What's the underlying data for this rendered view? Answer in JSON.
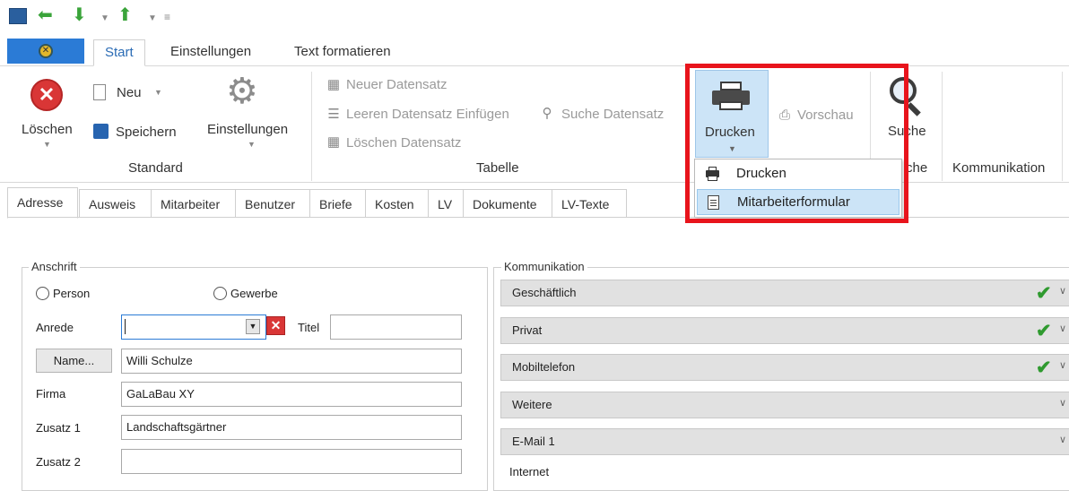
{
  "quick_access": {
    "icons": [
      "app-icon",
      "arrow-left-icon",
      "arrow-down-icon",
      "chevron-down-icon",
      "arrow-up-icon",
      "chevron-down-icon",
      "customize-icon"
    ]
  },
  "tabs": [
    {
      "label": "Start",
      "active": true
    },
    {
      "label": "Einstellungen",
      "active": false
    },
    {
      "label": "Text formatieren",
      "active": false
    }
  ],
  "ribbon": {
    "standard": {
      "group_label": "Standard",
      "loeschen": "Löschen",
      "neu": "Neu",
      "speichern": "Speichern",
      "einstellungen": "Einstellungen"
    },
    "tabelle": {
      "group_label": "Tabelle",
      "neuer_datensatz": "Neuer Datensatz",
      "leeren_einfuegen": "Leeren Datensatz Einfügen",
      "suche_datensatz": "Suche Datensatz",
      "loeschen_datensatz": "Löschen Datensatz"
    },
    "drucken_group": {
      "drucken": "Drucken",
      "vorschau": "Vorschau",
      "group_label_partial": "che"
    },
    "suche_group": {
      "suche": "Suche"
    },
    "kommunikation": {
      "group_label": "Kommunikation"
    }
  },
  "dropdown": {
    "items": [
      {
        "label": "Drucken",
        "icon": "printer-icon",
        "selected": false
      },
      {
        "label": "Mitarbeiterformular",
        "icon": "form-document-icon",
        "selected": true
      }
    ]
  },
  "form_tabs": [
    {
      "label": "Adresse",
      "active": true
    },
    {
      "label": "Ausweis",
      "active": false
    },
    {
      "label": "Mitarbeiter",
      "active": false
    },
    {
      "label": "Benutzer",
      "active": false
    },
    {
      "label": "Briefe",
      "active": false
    },
    {
      "label": "Kosten",
      "active": false
    },
    {
      "label": "LV",
      "active": false
    },
    {
      "label": "Dokumente",
      "active": false
    },
    {
      "label": "LV-Texte",
      "active": false
    }
  ],
  "anschrift": {
    "title": "Anschrift",
    "radio_person": "Person",
    "radio_gewerbe": "Gewerbe",
    "anrede_label": "Anrede",
    "anrede_value": "",
    "titel_label": "Titel",
    "titel_value": "",
    "name_button": "Name...",
    "name_value": "Willi Schulze",
    "firma_label": "Firma",
    "firma_value": "GaLaBau XY",
    "zusatz1_label": "Zusatz 1",
    "zusatz1_value": "Landschaftsgärtner",
    "zusatz2_label": "Zusatz 2",
    "zusatz2_value": ""
  },
  "kommunikation_box": {
    "title": "Kommunikation",
    "rows": [
      {
        "label": "Geschäftlich",
        "checked": true
      },
      {
        "label": "Privat",
        "checked": true
      },
      {
        "label": "Mobiltelefon",
        "checked": true
      },
      {
        "label": "Weitere",
        "checked": false
      },
      {
        "label": "E-Mail 1",
        "checked": false
      }
    ],
    "internet_label": "Internet"
  },
  "colors": {
    "accent_blue": "#2b7bd6",
    "highlight": "#cce4f7",
    "annotation_red": "#e8141c",
    "check_green": "#2f9a2f",
    "delete_red": "#d93636"
  }
}
